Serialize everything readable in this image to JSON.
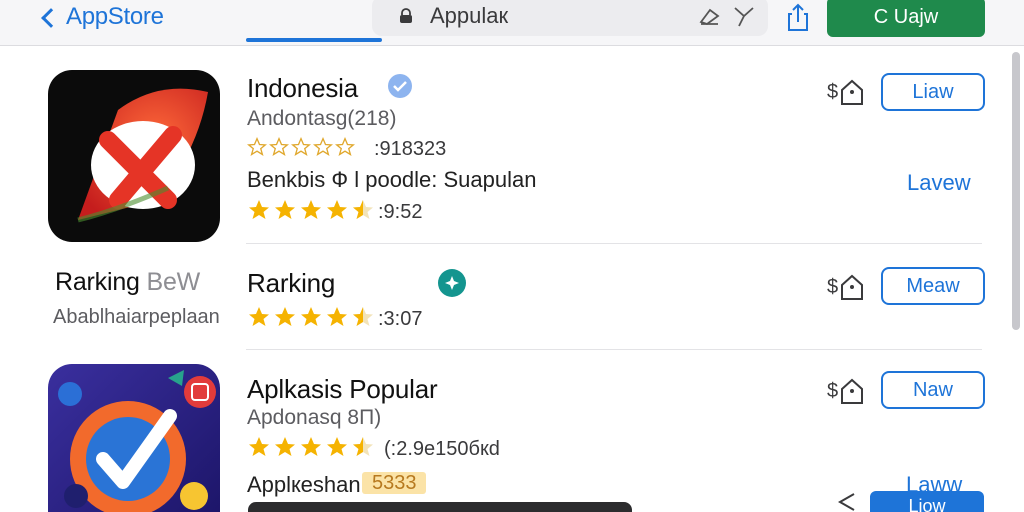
{
  "topbar": {
    "back_label": "AppStore",
    "search_value": "Appulaк",
    "search_placeholder": "",
    "share_icon": "share-icon",
    "action_button": "C Uajw"
  },
  "apps": [
    {
      "title": "Indonesia",
      "subtitle": "Andontasg(218)",
      "rating_count": ":918323",
      "desc": "Benkbis Ф l poodle: Suapulan",
      "rating": 4.5,
      "rating_value": ":9:52",
      "button_outline": "Liaw",
      "button_link": "Lavew",
      "verified": true
    },
    {
      "title": "Rarking",
      "rank_label": "Rarking",
      "rank_suffix": "BeW",
      "rank_sub": "Abablhaiarpeplaan",
      "rating": 4.5,
      "rating_value": ":3:07",
      "button_outline": "Meaw"
    },
    {
      "title": "Aplkasis Popular",
      "subtitle": "Apdonasq 8П)",
      "rating": 4.5,
      "rating_value": "(:2.9e150бкd",
      "desc": "Applкeshan",
      "desc_highlight": "5333",
      "button_outline": "Naw",
      "button_link": "Laww",
      "button_filled": "Liow"
    }
  ],
  "colors": {
    "accent": "#1e74d8",
    "get_green": "#1f8a4c",
    "star_gold": "#f5b301",
    "teal": "#14958f"
  }
}
